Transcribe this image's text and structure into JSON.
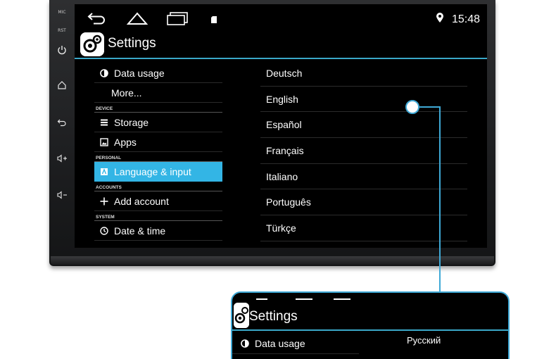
{
  "side_panel": {
    "mic_label": "MIC",
    "rst_label": "RST",
    "icons": [
      "power-icon",
      "home-icon",
      "back-icon",
      "volume-up-icon",
      "volume-down-icon"
    ]
  },
  "statusbar": {
    "time": "15:48",
    "icons": [
      "back-icon",
      "home-icon",
      "recent-apps-icon",
      "sd-card-icon",
      "location-icon"
    ]
  },
  "actionbar": {
    "title": "Settings"
  },
  "settings_list": {
    "data_usage": "Data usage",
    "more": "More...",
    "section_device": "DEVICE",
    "storage": "Storage",
    "apps": "Apps",
    "section_personal": "PERSONAL",
    "language_input": "Language & input",
    "section_accounts": "ACCOUNTS",
    "add_account": "Add account",
    "section_system": "SYSTEM",
    "date_time": "Date & time"
  },
  "languages": [
    "Deutsch",
    "English",
    "Español",
    "Français",
    "Italiano",
    "Português",
    "Türkçe"
  ],
  "zoom": {
    "title": "Settings",
    "data_usage": "Data usage",
    "language": "Русский"
  },
  "colors": {
    "accent": "#33b5e5",
    "callout": "#3fa9d6",
    "screen_bg": "#000000"
  }
}
